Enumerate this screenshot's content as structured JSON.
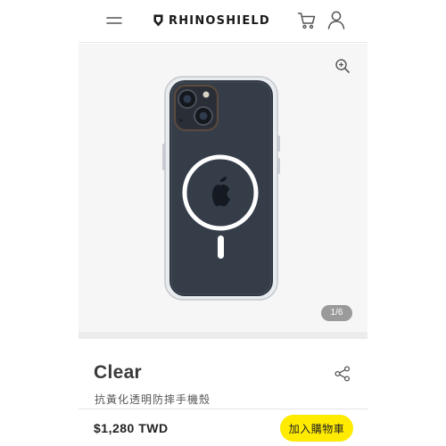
{
  "header": {
    "brand": "RHINOSHIELD",
    "icons": [
      "menu-icon",
      "rhino-logo-icon",
      "cart-icon",
      "user-icon"
    ]
  },
  "gallery": {
    "counter": "1/6",
    "icons": [
      "zoom-in-icon"
    ]
  },
  "product": {
    "title": "Clear",
    "subtitle": "抗黃化透明防摔手機殼",
    "icons": [
      "share-icon"
    ]
  },
  "bottom_bar": {
    "price": "$1,280 TWD",
    "add_to_cart_label": "加入購物車"
  },
  "colors": {
    "accent": "#ffeb00",
    "text": "#333333",
    "gallery_bg": "#f6f6f6",
    "counter_bg": "#9a9a9a"
  }
}
